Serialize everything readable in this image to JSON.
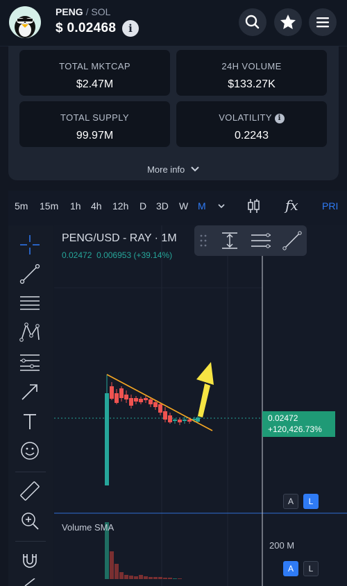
{
  "token": {
    "symbol": "PENG",
    "separator": "/",
    "chain": "SOL",
    "price": "$ 0.02468",
    "info_icon": "info-icon"
  },
  "header_buttons": {
    "search": "search-icon",
    "favorite": "star-icon",
    "menu": "hamburger-menu-icon"
  },
  "stats": [
    {
      "label": "TOTAL MKTCAP",
      "value": "$2.47M"
    },
    {
      "label": "24H VOLUME",
      "value": "$133.27K"
    },
    {
      "label": "TOTAL SUPPLY",
      "value": "99.97M"
    },
    {
      "label": "VOLATILITY",
      "value": "0.2243"
    }
  ],
  "more_info": "More info",
  "timeframes": [
    "5m",
    "15m",
    "1h",
    "4h",
    "12h",
    "D",
    "3D",
    "W",
    "M"
  ],
  "active_timeframe": "M",
  "toolbar": {
    "fx_label": "fx",
    "price_label": "PRI"
  },
  "chart": {
    "pair": "PENG/USD - RAY · 1M",
    "ohlc_a": "0.02472",
    "ohlc_b": "0.006953 (+39.14%)",
    "price_tag_price": "0.02472",
    "price_tag_change": "+120,426.73%",
    "scale_auto": "A",
    "scale_log": "L",
    "volume_title": "Volume SMA",
    "volume_tick": "200 M",
    "colors": {
      "up": "#26a69a",
      "down": "#ef5350",
      "trendline": "#f5a623",
      "arrow": "#f6e443",
      "accent": "#2f7bf5"
    }
  }
}
